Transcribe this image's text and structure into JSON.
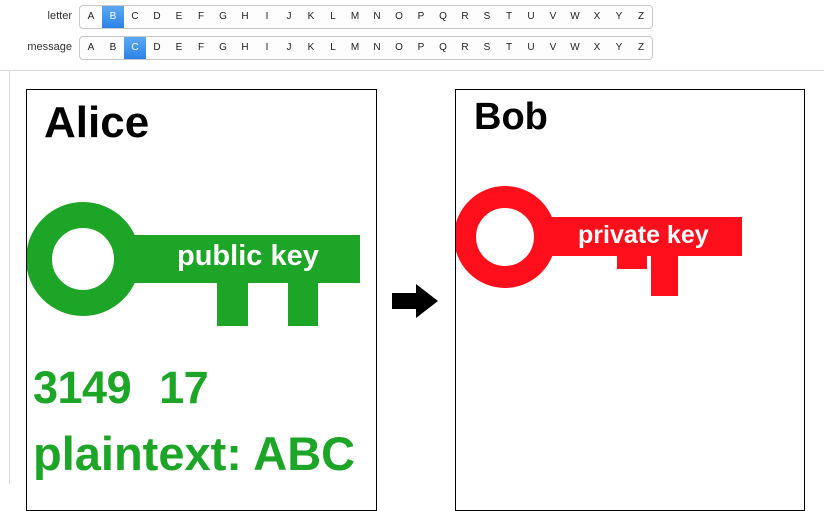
{
  "controls": {
    "letter_label": "letter",
    "message_label": "message",
    "alphabet": [
      "A",
      "B",
      "C",
      "D",
      "E",
      "F",
      "G",
      "H",
      "I",
      "J",
      "K",
      "L",
      "M",
      "N",
      "O",
      "P",
      "Q",
      "R",
      "S",
      "T",
      "U",
      "V",
      "W",
      "X",
      "Y",
      "Z"
    ],
    "letter_selected": "B",
    "message_selected": "C"
  },
  "alice": {
    "name": "Alice",
    "key_label": "public key",
    "key_color": "#1ca526",
    "modulus": "3149",
    "exponent": "17",
    "plaintext_label": "plaintext:",
    "plaintext_value": "ABC"
  },
  "bob": {
    "name": "Bob",
    "key_label": "private key",
    "key_color": "#fe0f1b"
  },
  "arrow_icon": "right-arrow-icon"
}
